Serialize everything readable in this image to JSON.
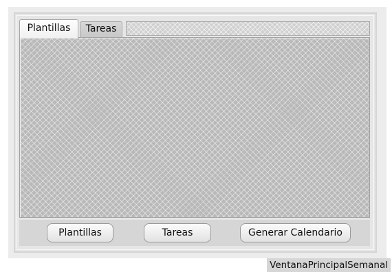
{
  "tabs": [
    {
      "label": "Plantillas",
      "active": true
    },
    {
      "label": "Tareas",
      "active": false
    }
  ],
  "buttons": {
    "plantillas_label": "Plantillas",
    "tareas_label": "Tareas",
    "generar_label": "Generar Calendario"
  },
  "window_name": "VentanaPrincipalSemanal",
  "colors": {
    "window_bg": "#ececec",
    "content_pattern_bg": "#b9b9b9",
    "button_bar_bg": "#d6d6d6"
  }
}
